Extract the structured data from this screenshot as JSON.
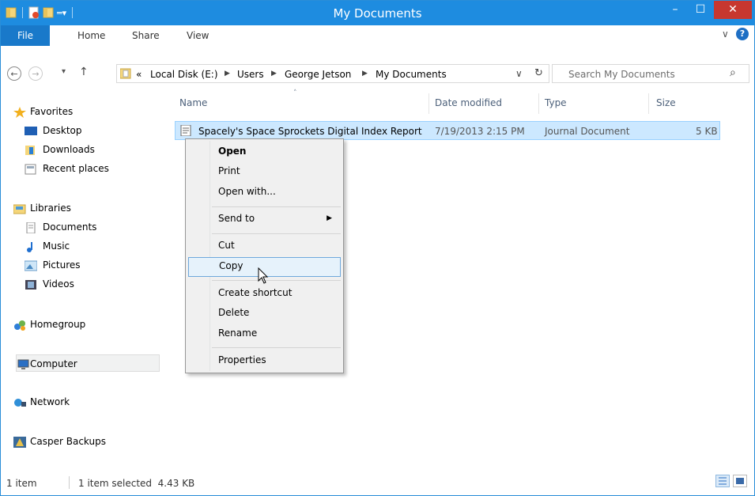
{
  "window": {
    "title": "My Documents",
    "minimize_glyph": "–",
    "maximize_glyph": "☐",
    "close_glyph": "✕"
  },
  "ribbon": {
    "tabs": [
      "File",
      "Home",
      "Share",
      "View"
    ],
    "expand_glyph": "∨",
    "help_glyph": "?"
  },
  "address": {
    "back_glyph": "←",
    "forward_glyph": "→",
    "recent_glyph": "▾",
    "up_glyph": "↑",
    "overflow": "«",
    "crumbs": [
      "Local Disk (E:)",
      "Users",
      "George Jetson",
      "My Documents"
    ],
    "dropdown_glyph": "∨",
    "refresh_glyph": "↻",
    "search_placeholder": "Search My Documents",
    "search_glyph": "⌕"
  },
  "navpane": {
    "favorites": "Favorites",
    "desktop": "Desktop",
    "downloads": "Downloads",
    "recent_places": "Recent places",
    "libraries": "Libraries",
    "documents": "Documents",
    "music": "Music",
    "pictures": "Pictures",
    "videos": "Videos",
    "homegroup": "Homegroup",
    "computer": "Computer",
    "network": "Network",
    "casper_backups": "Casper Backups"
  },
  "filelist": {
    "columns": {
      "name": "Name",
      "date": "Date modified",
      "type": "Type",
      "size": "Size"
    },
    "sort_glyph": "˄",
    "rows": [
      {
        "name": "Spacely's Space Sprockets Digital Index Report",
        "date": "7/19/2013 2:15 PM",
        "type": "Journal Document",
        "size": "5 KB"
      }
    ]
  },
  "context_menu": {
    "open": "Open",
    "print": "Print",
    "open_with": "Open with...",
    "send_to": "Send to",
    "submenu_glyph": "▶",
    "cut": "Cut",
    "copy": "Copy",
    "create_shortcut": "Create shortcut",
    "delete": "Delete",
    "rename": "Rename",
    "properties": "Properties"
  },
  "statusbar": {
    "count": "1 item",
    "selection": "1 item selected  4.43 KB"
  },
  "colors": {
    "titlebar": "#1e8ce0",
    "close": "#c7372f",
    "file_tab": "#1979ca",
    "selection": "#cce8ff",
    "menu_highlight": "#e6f2fb"
  }
}
